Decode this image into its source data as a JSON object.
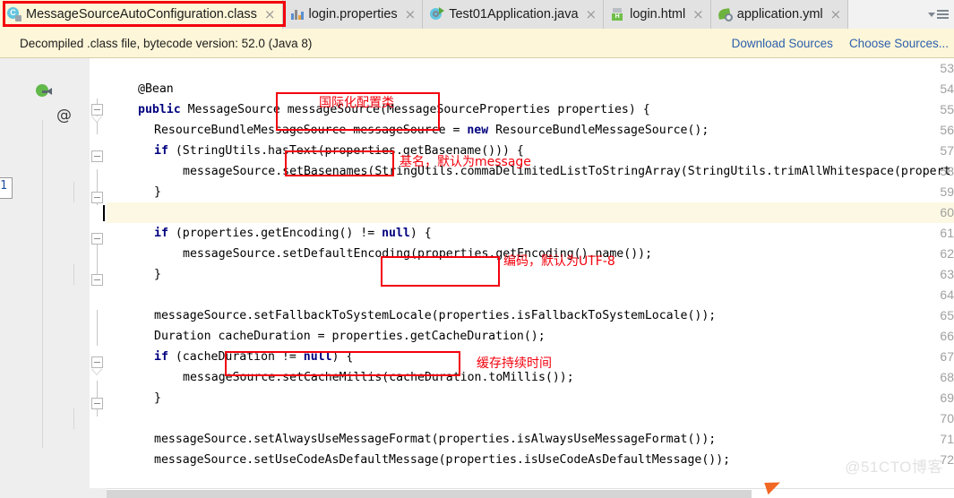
{
  "window": {
    "title": "MessageSourceAutoConfiguration.class — IntelliJ IDEA editor"
  },
  "tabs": [
    {
      "label": "MessageSourceAutoConfiguration.class",
      "icon": "java-class-icon",
      "active": true,
      "close": "×"
    },
    {
      "label": "login.properties",
      "icon": "properties-file-icon",
      "active": false,
      "close": "×"
    },
    {
      "label": "Test01Application.java",
      "icon": "java-runnable-class-icon",
      "active": false,
      "close": "×"
    },
    {
      "label": "login.html",
      "icon": "html-file-icon",
      "active": false,
      "close": "×"
    },
    {
      "label": "application.yml",
      "icon": "spring-yml-file-icon",
      "active": false,
      "close": "×"
    }
  ],
  "tabbar": {
    "overflow_chevron": "chevron-down-icon",
    "tab_list_menu": "tab-list-menu-icon"
  },
  "notification": {
    "message": "Decompiled .class file, bytecode version: 52.0 (Java 8)",
    "download_sources": "Download Sources",
    "choose_sources": "Choose Sources..."
  },
  "editor": {
    "current_line": 60,
    "first_line": 53,
    "last_line": 72,
    "line_numbers": [
      53,
      54,
      55,
      56,
      57,
      58,
      59,
      60,
      61,
      62,
      63,
      64,
      65,
      66,
      67,
      68,
      69,
      70,
      71,
      72
    ],
    "left_marker_label": "1",
    "gutter_icons": [
      {
        "line": 54,
        "icon": "bean-override-icon"
      },
      {
        "line": 55,
        "icon": "annotation-at-icon"
      }
    ],
    "lines": [
      {
        "n": 53,
        "indent": 0,
        "text": ""
      },
      {
        "n": 54,
        "indent": 1,
        "text": "@Bean"
      },
      {
        "n": 55,
        "indent": 1,
        "segments": [
          {
            "t": "public",
            "k": true
          },
          {
            "t": " MessageSource messageSource(MessageSourceProperties properties) {",
            "k": false
          }
        ]
      },
      {
        "n": 56,
        "indent": 2,
        "segments": [
          {
            "t": "ResourceBundleMessageSource messageSource = ",
            "k": false
          },
          {
            "t": "new",
            "k": true
          },
          {
            "t": " ResourceBundleMessageSource();",
            "k": false
          }
        ]
      },
      {
        "n": 57,
        "indent": 2,
        "segments": [
          {
            "t": "if",
            "k": true
          },
          {
            "t": " (StringUtils.hasText(properties.getBasename())) {",
            "k": false
          }
        ]
      },
      {
        "n": 58,
        "indent": 3,
        "text": "messageSource.setBasenames(StringUtils.commaDelimitedListToStringArray(StringUtils.trimAllWhitespace(propert"
      },
      {
        "n": 59,
        "indent": 2,
        "text": "}"
      },
      {
        "n": 60,
        "indent": 0,
        "text": ""
      },
      {
        "n": 61,
        "indent": 2,
        "segments": [
          {
            "t": "if",
            "k": true
          },
          {
            "t": " (properties.getEncoding() != ",
            "k": false
          },
          {
            "t": "null",
            "k": true
          },
          {
            "t": ") {",
            "k": false
          }
        ]
      },
      {
        "n": 62,
        "indent": 3,
        "text": "messageSource.setDefaultEncoding(properties.getEncoding().name());"
      },
      {
        "n": 63,
        "indent": 2,
        "text": "}"
      },
      {
        "n": 64,
        "indent": 0,
        "text": ""
      },
      {
        "n": 65,
        "indent": 2,
        "text": "messageSource.setFallbackToSystemLocale(properties.isFallbackToSystemLocale());"
      },
      {
        "n": 66,
        "indent": 2,
        "text": "Duration cacheDuration = properties.getCacheDuration();"
      },
      {
        "n": 67,
        "indent": 2,
        "segments": [
          {
            "t": "if",
            "k": true
          },
          {
            "t": " (cacheDuration != ",
            "k": false
          },
          {
            "t": "null",
            "k": true
          },
          {
            "t": ") {",
            "k": false
          }
        ]
      },
      {
        "n": 68,
        "indent": 3,
        "text": "messageSource.setCacheMillis(cacheDuration.toMillis());"
      },
      {
        "n": 69,
        "indent": 2,
        "text": "}"
      },
      {
        "n": 70,
        "indent": 0,
        "text": ""
      },
      {
        "n": 71,
        "indent": 2,
        "text": "messageSource.setAlwaysUseMessageFormat(properties.isAlwaysUseMessageFormat());"
      },
      {
        "n": 72,
        "indent": 2,
        "text": "messageSource.setUseCodeAsDefaultMessage(properties.isUseCodeAsDefaultMessage());"
      }
    ]
  },
  "annotations": [
    {
      "id": "i18n-config-class",
      "text": "国际化配置类",
      "box": true
    },
    {
      "id": "basename-note",
      "text": "基名，默认为message",
      "box": true
    },
    {
      "id": "encoding-note",
      "text": "编码，默认为UTF-8",
      "box": true
    },
    {
      "id": "cache-duration-note",
      "text": "缓存持续时间",
      "box": true
    }
  ],
  "colors": {
    "annotation_red": "#f3000c",
    "keyword_blue": "#00007f",
    "notification_bg": "#fdf6d8",
    "active_tab_bg": "#fdf6d8",
    "link_blue": "#2e5fae",
    "current_line_bg": "#fdf8e3"
  },
  "watermark": {
    "text": "@51CTO博客"
  }
}
